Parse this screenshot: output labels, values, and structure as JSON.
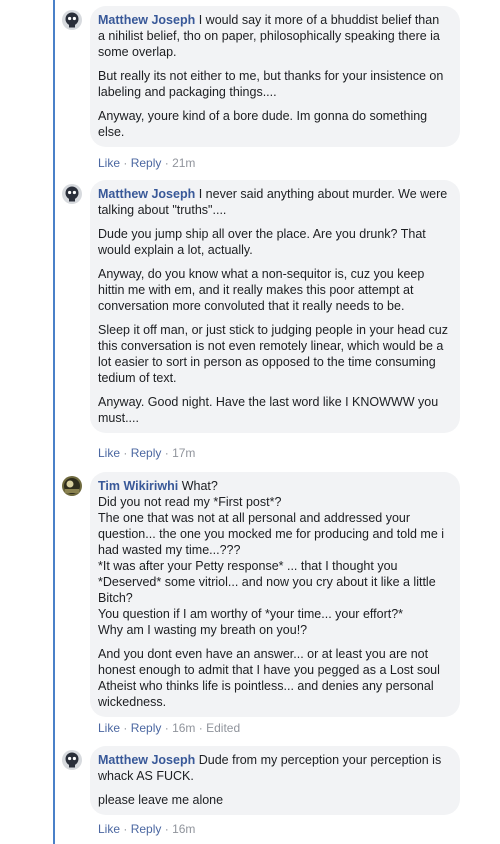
{
  "comments": [
    {
      "author": "Matthew Joseph",
      "avatar": "skull-avatar",
      "paragraphs": [
        "I would say it more of a bhuddist belief than a nihilist belief, tho on paper, philosophically speaking there ia some overlap.",
        "But really its not either to me, but thanks for your insistence on labeling and packaging things....",
        "Anyway, youre kind of a bore dude. Im gonna do something else."
      ],
      "like": "Like",
      "reply": "Reply",
      "time": "21m"
    },
    {
      "author": "Matthew Joseph",
      "avatar": "skull-avatar",
      "paragraphs": [
        "I never said anything about murder. We were talking about \"truths\"....",
        "Dude you jump ship all over the place. Are you drunk? That would explain a lot, actually.",
        "Anyway, do you know what a non-sequitor is, cuz you keep hittin me with em, and it really makes this poor attempt at conversation more convoluted that it really needs to be.",
        "Sleep it off man, or just stick to judging people in your head cuz this conversation is not even remotely linear, which would be a lot easier to sort in person as opposed to the time consuming tedium of text.",
        "Anyway. Good night. Have the last word like I KNOWWW you must...."
      ],
      "like": "Like",
      "reply": "Reply",
      "time": "17m"
    },
    {
      "author": "Tim Wikiriwhi",
      "avatar": "photo-avatar",
      "paragraphs": [
        "What?\nDid you not read my *First post*?\nThe one that was not at all personal and addressed your question... the one you mocked me for producing and told me i had wasted my time...???\n*It was after your Petty response* ... that I thought you *Deserved* some vitriol... and now you cry about it like a little Bitch?\nYou question if I am worthy of *your time... your effort?*\nWhy am I wasting my breath on you!?",
        "And you dont even have an answer... or at least you are not honest enough to admit that I have you pegged as a Lost soul Atheist who thinks life is pointless... and denies any personal wickedness."
      ],
      "like": "Like",
      "reply": "Reply",
      "time": "16m",
      "edited": "Edited"
    },
    {
      "author": "Matthew Joseph",
      "avatar": "skull-avatar",
      "paragraphs": [
        "Dude from my perception your perception is whack AS FUCK.",
        "please leave me alone"
      ],
      "like": "Like",
      "reply": "Reply",
      "time": "16m"
    }
  ],
  "colors": {
    "bubble": "#f2f3f5",
    "author": "#385898",
    "link": "#4b67a1",
    "meta": "#90949c",
    "thread_line": "#4a80c8"
  }
}
